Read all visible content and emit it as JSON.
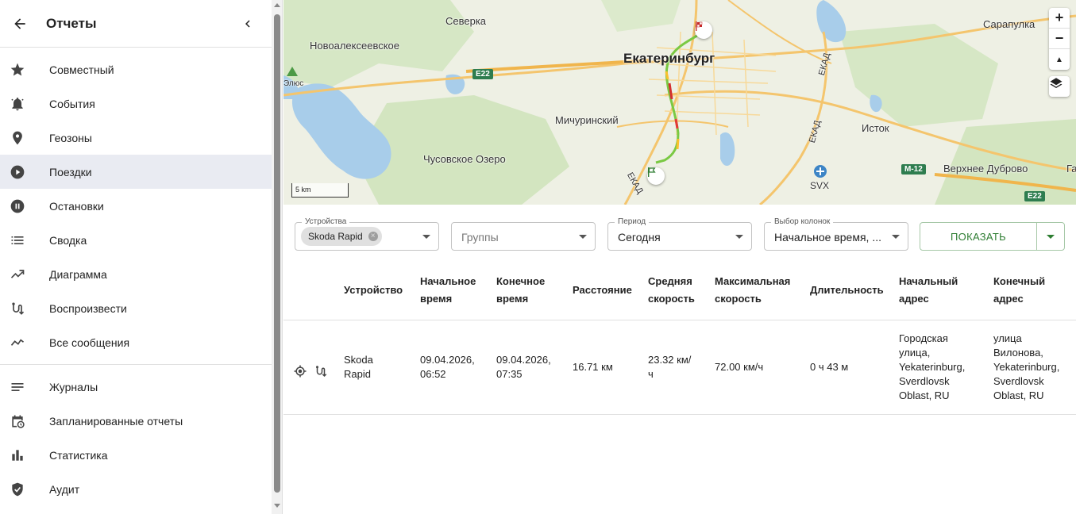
{
  "sidebar": {
    "title": "Отчеты",
    "items": [
      {
        "label": "Совместный",
        "icon": "star-icon"
      },
      {
        "label": "События",
        "icon": "bell-icon"
      },
      {
        "label": "Геозоны",
        "icon": "map-pin-icon"
      },
      {
        "label": "Поездки",
        "icon": "play-circle-icon",
        "active": true
      },
      {
        "label": "Остановки",
        "icon": "pause-circle-icon"
      },
      {
        "label": "Сводка",
        "icon": "list-icon"
      },
      {
        "label": "Диаграмма",
        "icon": "trending-up-icon"
      },
      {
        "label": "Воспроизвести",
        "icon": "route-icon"
      },
      {
        "label": "Все сообщения",
        "icon": "timeline-icon"
      }
    ],
    "items2": [
      {
        "label": "Журналы",
        "icon": "notes-icon"
      },
      {
        "label": "Запланированные отчеты",
        "icon": "calendar-clock-icon"
      },
      {
        "label": "Статистика",
        "icon": "bar-chart-icon"
      },
      {
        "label": "Аудит",
        "icon": "shield-check-icon"
      }
    ]
  },
  "map": {
    "labels": {
      "city": "Екатеринбург",
      "severka": "Северка",
      "novoalekseevskoe": "Новоалексеевское",
      "michurinsky": "Мичуринский",
      "chusovskoe": "Чусовское Озеро",
      "istok": "Исток",
      "verkhnee": "Верхнее Дуброво",
      "sarapulka": "Сарапулка",
      "elyus": "Элюс",
      "svx": "SVX",
      "ekad1": "ЕКАД",
      "ekad2": "ЕКАД",
      "ekad3": "ЕКАД",
      "ga": "Га"
    },
    "shields": {
      "e22a": "E22",
      "e22b": "E22",
      "m12": "M-12"
    },
    "scale": "5 km",
    "controls": {
      "zoom_in": "+",
      "zoom_out": "−",
      "compass": "▲"
    }
  },
  "filters": {
    "devices": {
      "legend": "Устройства",
      "chip": "Skoda Rapid"
    },
    "groups": {
      "placeholder": "Группы"
    },
    "period": {
      "legend": "Период",
      "value": "Сегодня"
    },
    "columns": {
      "legend": "Выбор колонок",
      "value": "Начальное время, ..."
    },
    "show_label": "ПОКАЗАТЬ"
  },
  "table": {
    "headers": {
      "device": "Устройство",
      "start_time_1": "Начальное",
      "start_time_2": "время",
      "end_time_1": "Конечное",
      "end_time_2": "время",
      "distance": "Расстояние",
      "avg_speed_1": "Средняя",
      "avg_speed_2": "скорость",
      "max_speed_1": "Максимальная",
      "max_speed_2": "скорость",
      "duration": "Длительность",
      "start_addr_1": "Начальный",
      "start_addr_2": "адрес",
      "end_addr_1": "Конечный",
      "end_addr_2": "адрес"
    },
    "rows": [
      {
        "device_1": "Skoda",
        "device_2": "Rapid",
        "start_1": "09.04.2026,",
        "start_2": "06:52",
        "end_1": "09.04.2026,",
        "end_2": "07:35",
        "distance": "16.71 км",
        "avg_1": "23.32 км/",
        "avg_2": "ч",
        "max": "72.00 км/ч",
        "duration": "0 ч 43 м",
        "start_addr": [
          "Городская",
          "улица,",
          "Yekaterinburg,",
          "Sverdlovsk",
          "Oblast, RU"
        ],
        "end_addr": [
          "улица",
          "Вилонова,",
          "Yekaterinburg,",
          "Sverdlovsk",
          "Oblast, RU"
        ]
      }
    ]
  },
  "colors": {
    "accent": "#2e7d32",
    "active_bg": "#e9ebf2",
    "water": "#a8cdea",
    "forest": "#cfe3bd"
  }
}
